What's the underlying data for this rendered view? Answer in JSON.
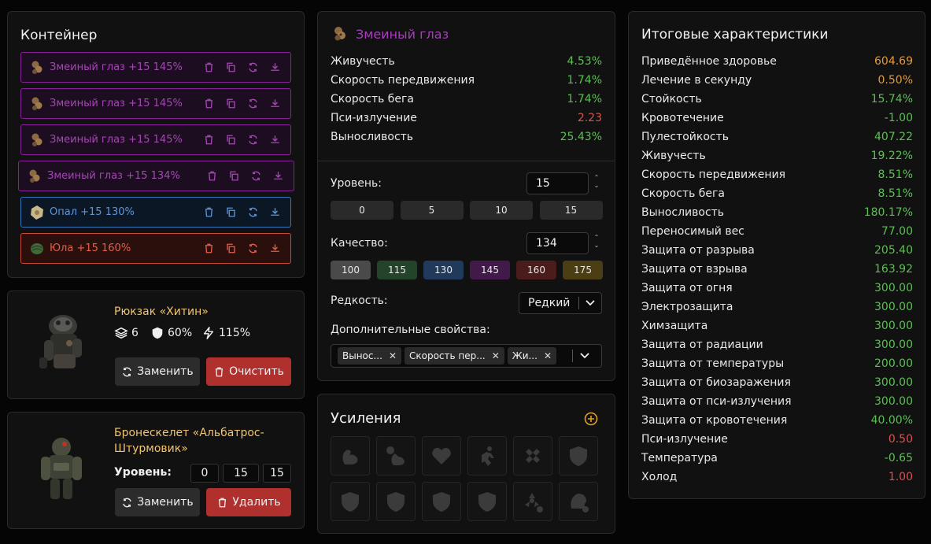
{
  "container": {
    "title": "Контейнер",
    "slots": [
      {
        "label": "Змеиный глаз +15 145%",
        "variant": "purple"
      },
      {
        "label": "Змеиный глаз +15 145%",
        "variant": "purple"
      },
      {
        "label": "Змеиный глаз +15 145%",
        "variant": "purple"
      },
      {
        "label": "Змеиный глаз +15 134%",
        "variant": "purple"
      },
      {
        "label": "Опал +15 130%",
        "variant": "blue"
      },
      {
        "label": "Юла +15 160%",
        "variant": "red"
      }
    ],
    "slot_actions": [
      "trash-icon",
      "copy-icon",
      "refresh-icon",
      "download-icon"
    ]
  },
  "backpack": {
    "name": "Рюкзак «Хитин»",
    "slots_count": "6",
    "protection": "60%",
    "efficiency": "115%",
    "replace_label": "Заменить",
    "clear_label": "Очистить"
  },
  "armor": {
    "name": "Бронескелет «Альбатрос-Штурмовик»",
    "level_label": "Уровень:",
    "levels": [
      "0",
      "15",
      "15"
    ],
    "replace_label": "Заменить",
    "delete_label": "Удалить"
  },
  "artifact": {
    "title": "Змеиный глаз",
    "stats": [
      {
        "name": "Живучесть",
        "value": "4.53%",
        "tone": "green"
      },
      {
        "name": "Скорость передвижения",
        "value": "1.74%",
        "tone": "green"
      },
      {
        "name": "Скорость бега",
        "value": "1.74%",
        "tone": "green"
      },
      {
        "name": "Пси-излучение",
        "value": "2.23",
        "tone": "red"
      },
      {
        "name": "Выносливость",
        "value": "25.43%",
        "tone": "green"
      }
    ],
    "level_label": "Уровень:",
    "level_value": "15",
    "level_presets": [
      "0",
      "5",
      "10",
      "15"
    ],
    "quality_label": "Качество:",
    "quality_value": "134",
    "quality_presets": [
      {
        "label": "100",
        "color": "#4a4a4a"
      },
      {
        "label": "115",
        "color": "#23432a"
      },
      {
        "label": "130",
        "color": "#213a5c"
      },
      {
        "label": "145",
        "color": "#421a4a"
      },
      {
        "label": "160",
        "color": "#4a1c1c"
      },
      {
        "label": "175",
        "color": "#4b3e14"
      }
    ],
    "rarity_label": "Редкость:",
    "rarity_value": "Редкий",
    "extra_label": "Дополнительные свойства:",
    "extra_chips": [
      "Вынос...",
      "Скорость пер...",
      "Жи..."
    ]
  },
  "boosts": {
    "title": "Усиления",
    "icons_row1": [
      "strength-icon",
      "timed-strength-icon",
      "heart-plus-icon",
      "running-icon",
      "bandage-icon",
      "shield-icon"
    ],
    "icons_row2": [
      "thermometer-shield-icon",
      "radiation-shield-icon",
      "biohazard-shield-icon",
      "psi-shield-icon",
      "radiation-minus-icon",
      "psi-head-minus-icon"
    ]
  },
  "totals": {
    "title": "Итоговые характеристики",
    "rows": [
      {
        "name": "Приведённое здоровье",
        "value": "604.69",
        "tone": "orange"
      },
      {
        "name": "Лечение в секунду",
        "value": "0.50%",
        "tone": "orange"
      },
      {
        "name": "Стойкость",
        "value": "15.74%",
        "tone": "green"
      },
      {
        "name": "Кровотечение",
        "value": "-1.00",
        "tone": "green"
      },
      {
        "name": "Пулестойкость",
        "value": "407.22",
        "tone": "green"
      },
      {
        "name": "Живучесть",
        "value": "19.22%",
        "tone": "green"
      },
      {
        "name": "Скорость передвижения",
        "value": "8.51%",
        "tone": "green"
      },
      {
        "name": "Скорость бега",
        "value": "8.51%",
        "tone": "green"
      },
      {
        "name": "Выносливость",
        "value": "180.17%",
        "tone": "green"
      },
      {
        "name": "Переносимый вес",
        "value": "77.00",
        "tone": "green"
      },
      {
        "name": "Защита от разрыва",
        "value": "205.40",
        "tone": "green"
      },
      {
        "name": "Защита от взрыва",
        "value": "163.92",
        "tone": "green"
      },
      {
        "name": "Защита от огня",
        "value": "300.00",
        "tone": "green"
      },
      {
        "name": "Электрозащита",
        "value": "300.00",
        "tone": "green"
      },
      {
        "name": "Химзащита",
        "value": "300.00",
        "tone": "green"
      },
      {
        "name": "Защита от радиации",
        "value": "300.00",
        "tone": "green"
      },
      {
        "name": "Защита от температуры",
        "value": "200.00",
        "tone": "green"
      },
      {
        "name": "Защита от биозаражения",
        "value": "300.00",
        "tone": "green"
      },
      {
        "name": "Защита от пси-излучения",
        "value": "300.00",
        "tone": "green"
      },
      {
        "name": "Защита от кровотечения",
        "value": "40.00%",
        "tone": "green"
      },
      {
        "name": "Пси-излучение",
        "value": "0.50",
        "tone": "red"
      },
      {
        "name": "Температура",
        "value": "-0.65",
        "tone": "green"
      },
      {
        "name": "Холод",
        "value": "1.00",
        "tone": "red"
      }
    ]
  }
}
